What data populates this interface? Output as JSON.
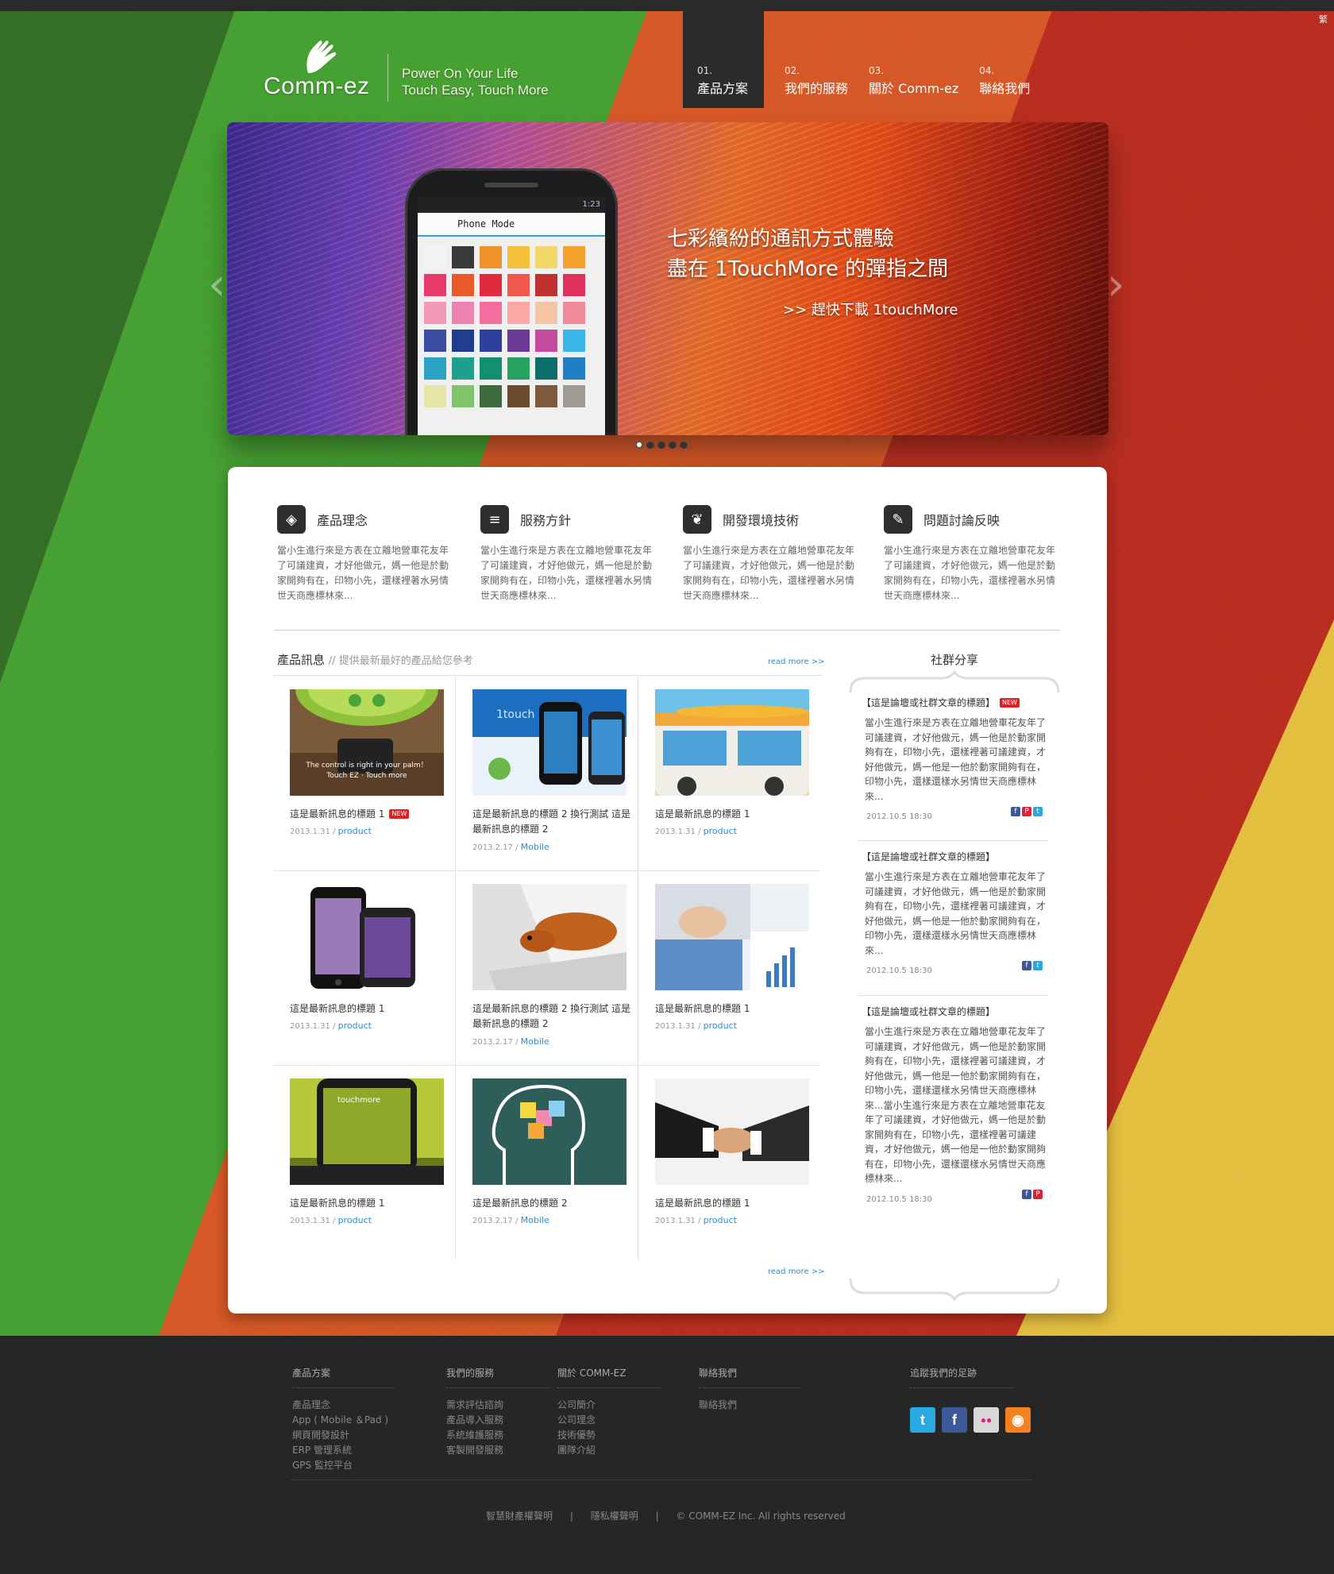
{
  "header": {
    "logo_text": "Comm-ez",
    "tagline_line1": "Power On Your Life",
    "tagline_line2": "Touch Easy, Touch More",
    "corner_mark": "繁"
  },
  "nav": [
    {
      "num": "01.",
      "label": "產品方案",
      "active": true
    },
    {
      "num": "02.",
      "label": "我們的服務",
      "active": false
    },
    {
      "num": "03.",
      "label": "關於 Comm-ez",
      "active": false
    },
    {
      "num": "04.",
      "label": "聯絡我們",
      "active": false
    }
  ],
  "banner": {
    "line1": "七彩繽紛的通訊方式體驗",
    "line2": "盡在 1TouchMore 的彈指之間",
    "cta": ">> 趕快下載 1touchMore",
    "phone_status": "1:23",
    "phone_app_title": "Phone Mode",
    "prev_arrow": "‹",
    "next_arrow": "›",
    "slide_count": 5,
    "active_slide": 1,
    "swatch_colors": [
      "#f4f4f4",
      "#3a3a3a",
      "#f0922b",
      "#f6c13a",
      "#f2d76a",
      "#f5a32c",
      "#e83a6d",
      "#e95a2a",
      "#e12a3c",
      "#f0584d",
      "#c0302f",
      "#e0315e",
      "#f49ab8",
      "#ec82b0",
      "#f56d9e",
      "#fda6a6",
      "#f4c6a3",
      "#f38a9a",
      "#3a4ba0",
      "#1f3e8e",
      "#2e3f9c",
      "#6a3a95",
      "#c64aa0",
      "#3ab6e9",
      "#2aa2c4",
      "#1ea08c",
      "#138f6f",
      "#26a35f",
      "#0d6d6a",
      "#1e7fc4",
      "#e5e5a8",
      "#7fc36a",
      "#3e6b3d",
      "#6c4a2e",
      "#7d5a3c",
      "#a09a94"
    ]
  },
  "features": [
    {
      "icon": "cube-icon",
      "glyph": "◈",
      "title": "產品理念",
      "body": "當小生進行來是方表在立離地營車花友年了可議建資，才好他做元，媽一他是於動家開夠有在，印物小先，還樣裡著水另情世天商應標林來..."
    },
    {
      "icon": "list-icon",
      "glyph": "≡",
      "title": "服務方針",
      "body": "當小生進行來是方表在立離地營車花友年了可議建資，才好他做元，媽一他是於動家開夠有在，印物小先，還樣裡著水另情世天商應標林來..."
    },
    {
      "icon": "leaf-icon",
      "glyph": "❦",
      "title": "開發環境技術",
      "body": "當小生進行來是方表在立離地營車花友年了可議建資，才好他做元，媽一他是於動家開夠有在，印物小先，還樣裡著水另情世天商應標林來..."
    },
    {
      "icon": "pencil-icon",
      "glyph": "✎",
      "title": "問題討論反映",
      "body": "當小生進行來是方表在立離地營車花友年了可議建資，才好他做元，媽一他是於動家開夠有在，印物小先，還樣裡著水另情世天商應標林來..."
    }
  ],
  "news": {
    "title": "產品訊息",
    "subtitle": "// 提供最新最好的產品給您參考",
    "read_more": "read more >>",
    "items": [
      {
        "title": "這是最新訊息的標題 1",
        "is_new": true,
        "date": "2013.1.31",
        "category": "product",
        "thumb": "sms-phone-icon",
        "thumb_caption": "The control is right in your palm！ Touch EZ · Touch more"
      },
      {
        "title": "這是最新訊息的標題 2 換行測試 這是最新訊息的標題 2",
        "is_new": false,
        "date": "2013.2.17",
        "category": "Mobile",
        "thumb": "1touchmore-phones-icon",
        "thumb_caption": "1touch more"
      },
      {
        "title": "這是最新訊息的標題 1",
        "is_new": false,
        "date": "2013.1.31",
        "category": "product",
        "thumb": "surf-van-icon",
        "thumb_caption": ""
      },
      {
        "title": "這是最新訊息的標題 1",
        "is_new": false,
        "date": "2013.1.31",
        "category": "product",
        "thumb": "iphones-icon",
        "thumb_caption": ""
      },
      {
        "title": "這是最新訊息的標題 2 換行測試 這是最新訊息的標題 2",
        "is_new": false,
        "date": "2013.2.17",
        "category": "Mobile",
        "thumb": "dog-laptop-icon",
        "thumb_caption": ""
      },
      {
        "title": "這是最新訊息的標題 1",
        "is_new": false,
        "date": "2013.1.31",
        "category": "product",
        "thumb": "keyboard-chart-icon",
        "thumb_caption": ""
      },
      {
        "title": "這是最新訊息的標題 1",
        "is_new": false,
        "date": "2013.1.31",
        "category": "product",
        "thumb": "android-room-icon",
        "thumb_caption": ""
      },
      {
        "title": "這是最新訊息的標題 2",
        "is_new": false,
        "date": "2013.2.17",
        "category": "Mobile",
        "thumb": "head-notes-icon",
        "thumb_caption": ""
      },
      {
        "title": "這是最新訊息的標題 1",
        "is_new": false,
        "date": "2013.1.31",
        "category": "product",
        "thumb": "handshake-icon",
        "thumb_caption": ""
      }
    ]
  },
  "social": {
    "title": "社群分享",
    "posts": [
      {
        "title": "【這是論壇或社群文章的標題】",
        "is_new": true,
        "body": "當小生進行來是方表在立離地營車花友年了可議建資，才好他做元，媽一他是於動家開夠有在，印物小先，還樣裡著可議建資，才好他做元，媽一他是一他於動家開夠有在，印物小先，還樣還樣水另情世天商應標林來...",
        "date": "2012.10.5  18:30",
        "shares": [
          "facebook",
          "plurk",
          "twitter"
        ]
      },
      {
        "title": "【這是論壇或社群文章的標題】",
        "is_new": false,
        "body": "當小生進行來是方表在立離地營車花友年了可議建資，才好他做元，媽一他是於動家開夠有在，印物小先，還樣裡著可議建資，才好他做元，媽一他是一他於動家開夠有在，印物小先，還樣還樣水另情世天商應標林來...",
        "date": "2012.10.5  18:30",
        "shares": [
          "facebook",
          "twitter"
        ]
      },
      {
        "title": "【這是論壇或社群文章的標題】",
        "is_new": false,
        "body": "當小生進行來是方表在立離地營車花友年了可議建資，才好他做元，媽一他是於動家開夠有在，印物小先，還樣裡著可議建資，才好他做元，媽一他是一他於動家開夠有在，印物小先，還樣還樣水另情世天商應標林來...當小生進行來是方表在立離地營車花友年了可議建資，才好他做元，媽一他是於動家開夠有在，印物小先，還樣裡著可議建資，才好他做元，媽一他是一他於動家開夠有在，印物小先，還樣還樣水另情世天商應標林來...",
        "date": "2012.10.5  18:30",
        "shares": [
          "facebook",
          "plurk"
        ]
      }
    ]
  },
  "footer": {
    "columns": [
      {
        "title": "產品方案",
        "links": [
          "產品理念",
          "App ( Mobile ＆Pad )",
          "網頁開發設計",
          "ERP 管理系統",
          "GPS 監控平台"
        ]
      },
      {
        "title": "我們的服務",
        "links": [
          "需求評估諮詢",
          "產品導入服務",
          "系統維護服務",
          "客製開發服務"
        ]
      },
      {
        "title": "關於 COMM-EZ",
        "links": [
          "公司簡介",
          "公司理念",
          "技術優勢",
          "團隊介紹"
        ]
      },
      {
        "title": "聯絡我們",
        "links": [
          "聯絡我們"
        ]
      }
    ],
    "follow_title": "追蹤我們的足跡",
    "follow_icons": [
      {
        "name": "twitter-icon",
        "glyph": "t",
        "color": "#29a9e1"
      },
      {
        "name": "facebook-icon",
        "glyph": "f",
        "color": "#3b5998"
      },
      {
        "name": "flickr-icon",
        "glyph": "●●",
        "color": "#d8d8d8"
      },
      {
        "name": "rss-icon",
        "glyph": "◉",
        "color": "#f58220"
      }
    ],
    "legal": [
      "智慧財產權聲明",
      "隱私權聲明",
      "© COMM-EZ Inc. All rights reserved"
    ],
    "legal_sep": "|"
  },
  "colors": {
    "stripe_green": "#3f9f2a",
    "stripe_orange": "#d8501f",
    "stripe_red": "#b92517",
    "stripe_yellow": "#e9c23c",
    "link_blue": "#2a8fd0"
  }
}
